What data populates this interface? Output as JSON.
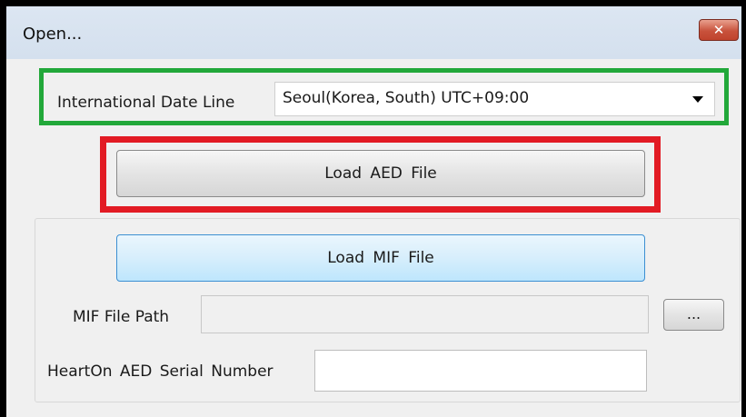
{
  "window": {
    "title": "Open...",
    "close_glyph": "✕"
  },
  "timezone": {
    "label": "International Date Line",
    "selected": "Seoul(Korea, South) UTC+09:00"
  },
  "buttons": {
    "load_aed": "Load  AED  File",
    "load_mif": "Load  MIF  File",
    "browse": "..."
  },
  "mif": {
    "path_label": "MIF File Path",
    "path_value": ""
  },
  "serial": {
    "label": "HeartOn AED  Serial  Number",
    "value": ""
  },
  "colors": {
    "highlight_green": "#22a83a",
    "highlight_red": "#e21b24"
  }
}
